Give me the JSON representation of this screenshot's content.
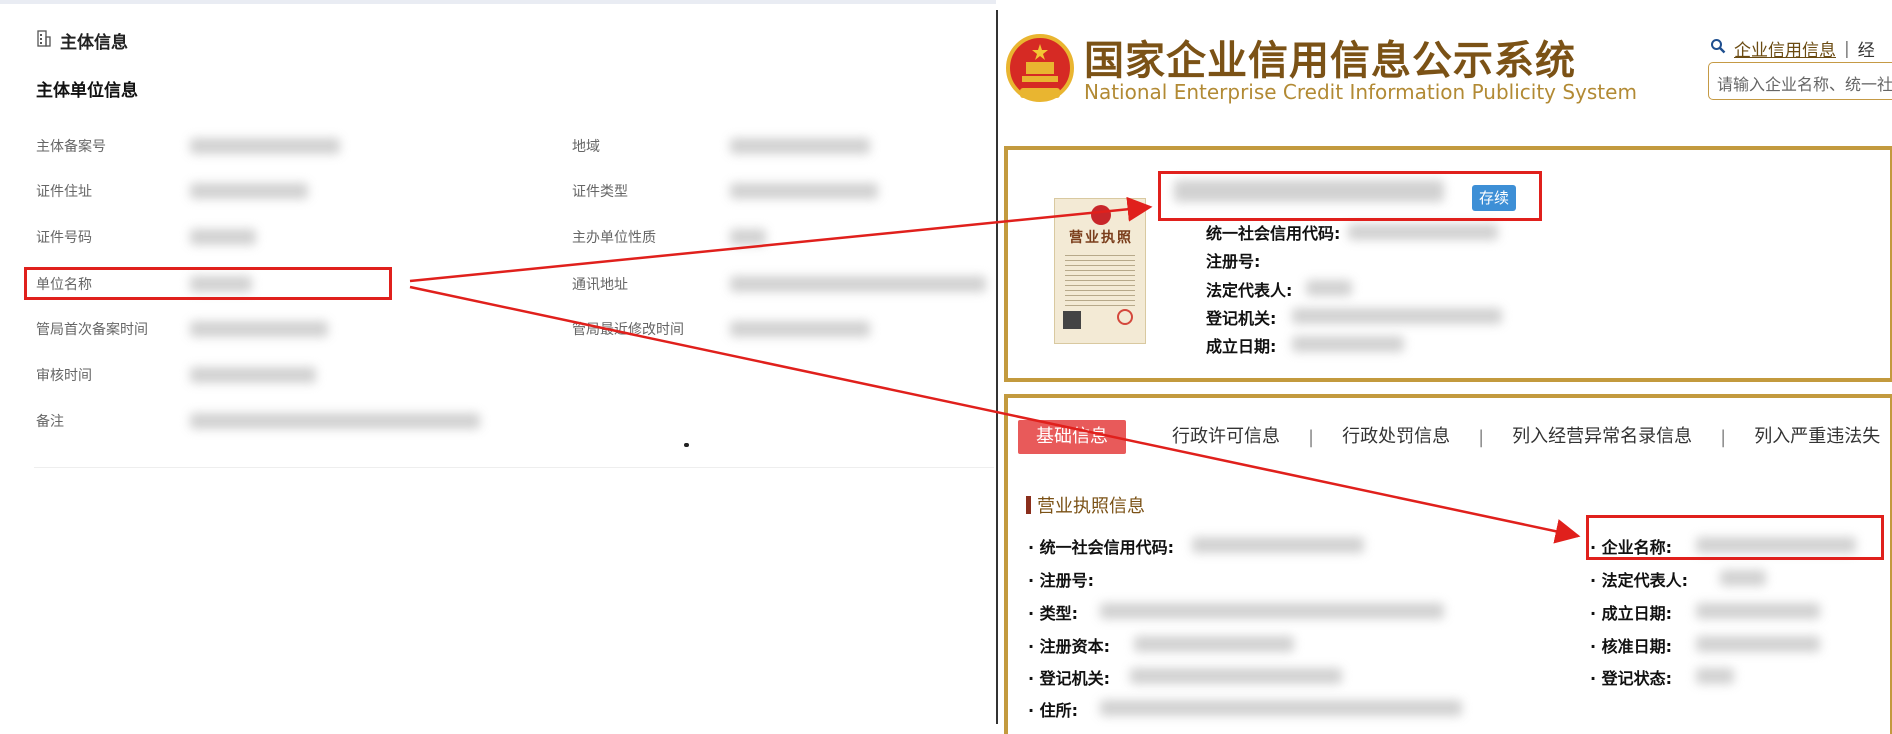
{
  "left_panel": {
    "section_title": "主体信息",
    "subsection_title": "主体单位信息",
    "fields": [
      {
        "label": "主体备案号",
        "value": ""
      },
      {
        "label": "地域",
        "value": ""
      },
      {
        "label": "证件住址",
        "value": ""
      },
      {
        "label": "证件类型",
        "value": ""
      },
      {
        "label": "证件号码",
        "value": ""
      },
      {
        "label": "主办单位性质",
        "value": ""
      },
      {
        "label": "单位名称",
        "value": ""
      },
      {
        "label": "通讯地址",
        "value": ""
      },
      {
        "label": "管局首次备案时间",
        "value": ""
      },
      {
        "label": "管局最近修改时间",
        "value": ""
      },
      {
        "label": "审核时间",
        "value": ""
      },
      {
        "label": "备注",
        "value": ""
      }
    ]
  },
  "right_panel": {
    "header": {
      "title_cn": "国家企业信用信息公示系统",
      "title_en": "National Enterprise Credit Information Publicity System",
      "link_1": "企业信用信息",
      "link_sep": "|",
      "link_2": "经",
      "search_placeholder": "请输入企业名称、统一社"
    },
    "license": {
      "title": "营业执照"
    },
    "company": {
      "status": "存续",
      "fields": [
        {
          "label": "统一社会信用代码:"
        },
        {
          "label": "注册号:"
        },
        {
          "label": "法定代表人:"
        },
        {
          "label": "登记机关:"
        },
        {
          "label": "成立日期:"
        }
      ]
    },
    "tabs": [
      "基础信息",
      "行政许可信息",
      "行政处罚信息",
      "列入经营异常名录信息",
      "列入严重违法失"
    ],
    "tab_sep": "|",
    "section_title": "营业执照信息",
    "details_left": [
      "· 统一社会信用代码:",
      "· 注册号:",
      "· 类型:",
      "· 注册资本:",
      "· 登记机关:",
      "· 住所:"
    ],
    "details_right": [
      "· 企业名称:",
      "· 法定代表人:",
      "· 成立日期:",
      "· 核准日期:",
      "· 登记状态:"
    ]
  },
  "colors": {
    "annotation_red": "#e0201c",
    "gold": "#c39a3e",
    "brand_brown": "#7b5216",
    "status_blue": "#3d8fd6",
    "active_tab": "#e85a5a"
  },
  "icons": {
    "left_section": "building-icon",
    "search": "magnifier-icon",
    "emblem": "national-emblem-icon"
  }
}
